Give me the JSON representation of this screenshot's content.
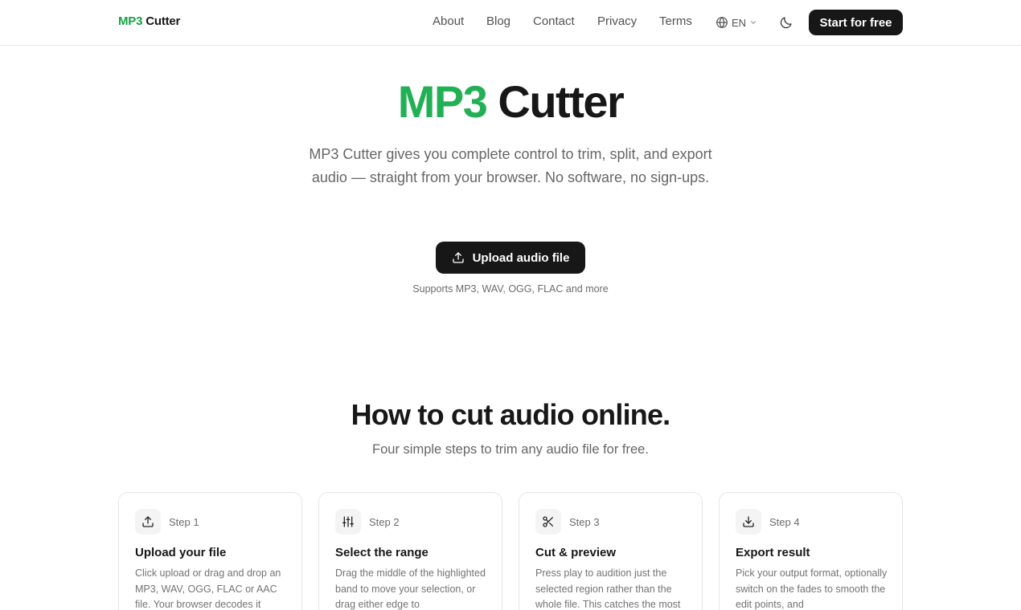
{
  "header": {
    "logo_accent": "MP3",
    "logo_rest": "Cutter",
    "nav": [
      "About",
      "Blog",
      "Contact",
      "Privacy",
      "Terms"
    ],
    "language": "EN",
    "cta_label": "Start for free"
  },
  "hero": {
    "title_accent": "MP3",
    "title_rest": "Cutter",
    "subtitle": "MP3 Cutter gives you complete control to trim, split, and export audio — straight from your browser. No software, no sign-ups.",
    "upload_label": "Upload audio file",
    "supports": "Supports MP3, WAV, OGG, FLAC and more"
  },
  "how": {
    "title": "How to cut audio online.",
    "subtitle": "Four simple steps to trim any audio file for free.",
    "steps": [
      {
        "step": "Step 1",
        "title": "Upload your file",
        "desc": "Click upload or drag and drop an MP3, WAV, OGG, FLAC or AAC file. Your browser decodes it",
        "icon": "upload-icon"
      },
      {
        "step": "Step 2",
        "title": "Select the range",
        "desc": "Drag the middle of the highlighted band to move your selection, or drag either edge to",
        "icon": "sliders-icon"
      },
      {
        "step": "Step 3",
        "title": "Cut & preview",
        "desc": "Press play to audition just the selected region rather than the whole file. This catches the most",
        "icon": "scissors-icon"
      },
      {
        "step": "Step 4",
        "title": "Export result",
        "desc": "Pick your output format, optionally switch on the fades to smooth the edit points, and",
        "icon": "download-icon"
      }
    ]
  },
  "colors": {
    "accent": "#22b055",
    "dark": "#171717",
    "muted": "#666666"
  }
}
